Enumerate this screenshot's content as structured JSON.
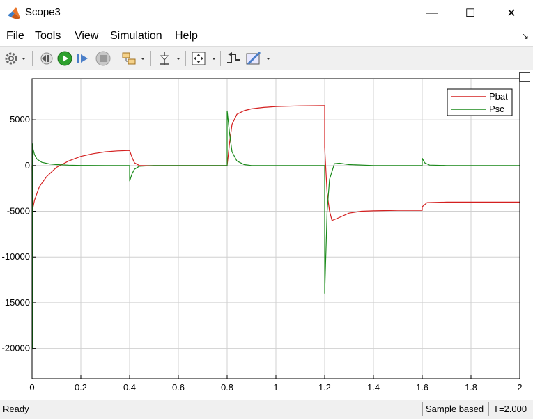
{
  "window": {
    "title": "Scope3",
    "minimize_glyph": "—",
    "maximize_glyph": "☐",
    "close_glyph": "✕"
  },
  "menu": {
    "items": [
      "File",
      "Tools",
      "View",
      "Simulation",
      "Help"
    ],
    "overflow_glyph": "↘"
  },
  "toolbar": {
    "buttons": [
      "settings-gear-icon",
      "step-back-icon",
      "run-icon",
      "step-forward-icon",
      "stop-icon",
      "highlight-block-icon",
      "cursor-measure-icon",
      "zoom-fit-icon",
      "triggers-icon",
      "style-icon"
    ]
  },
  "colors": {
    "pbat": "#d42020",
    "psc": "#1a8a1a",
    "grid": "#d0d0d0",
    "axis": "#000000"
  },
  "chart_data": {
    "type": "line",
    "title": "",
    "xlabel": "",
    "ylabel": "",
    "xlim": [
      0,
      2
    ],
    "ylim": [
      -23300,
      9500
    ],
    "x_ticks": [
      0,
      0.2,
      0.4,
      0.6,
      0.8,
      1,
      1.2,
      1.4,
      1.6,
      1.8,
      2
    ],
    "x_tick_labels": [
      "0",
      "0.2",
      "0.4",
      "0.6",
      "0.8",
      "1",
      "1.2",
      "1.4",
      "1.6",
      "1.8",
      "2"
    ],
    "y_ticks": [
      5000,
      0,
      -5000,
      -10000,
      -15000,
      -20000
    ],
    "y_tick_labels": [
      "5000",
      "0",
      "-5000",
      "-10000",
      "-15000",
      "-20000"
    ],
    "grid": true,
    "legend_position": "top-right",
    "series": [
      {
        "name": "Pbat",
        "x": [
          0,
          0.002,
          0.01,
          0.03,
          0.06,
          0.1,
          0.15,
          0.2,
          0.25,
          0.3,
          0.35,
          0.4,
          0.41,
          0.42,
          0.44,
          0.5,
          0.6,
          0.7,
          0.8,
          0.81,
          0.82,
          0.84,
          0.87,
          0.9,
          0.95,
          1.0,
          1.1,
          1.2,
          1.2,
          1.21,
          1.22,
          1.23,
          1.25,
          1.3,
          1.35,
          1.4,
          1.5,
          1.6,
          1.6,
          1.62,
          1.7,
          1.8,
          1.9,
          2.0
        ],
        "y": [
          0,
          -4800,
          -3800,
          -2300,
          -1200,
          -200,
          500,
          1000,
          1300,
          1500,
          1600,
          1650,
          900,
          300,
          0,
          0,
          0,
          0,
          0,
          2500,
          4500,
          5600,
          6000,
          6200,
          6350,
          6450,
          6520,
          6550,
          2000,
          -3000,
          -5000,
          -6000,
          -5800,
          -5200,
          -5000,
          -4950,
          -4900,
          -4900,
          -4500,
          -4050,
          -4000,
          -4000,
          -4000,
          -4000
        ]
      },
      {
        "name": "Psc",
        "x": [
          0,
          0.001,
          0.002,
          0.004,
          0.01,
          0.02,
          0.04,
          0.07,
          0.1,
          0.15,
          0.2,
          0.3,
          0.4,
          0.4,
          0.41,
          0.42,
          0.44,
          0.5,
          0.6,
          0.7,
          0.8,
          0.8,
          0.81,
          0.82,
          0.84,
          0.87,
          0.9,
          1.0,
          1.1,
          1.2,
          1.2,
          1.205,
          1.21,
          1.22,
          1.24,
          1.26,
          1.3,
          1.4,
          1.5,
          1.6,
          1.6,
          1.61,
          1.63,
          1.7,
          1.8,
          2.0
        ],
        "y": [
          0,
          -20000,
          2400,
          1800,
          1200,
          700,
          350,
          180,
          100,
          40,
          10,
          0,
          0,
          -1700,
          -900,
          -400,
          -80,
          0,
          0,
          0,
          0,
          6000,
          3500,
          1500,
          500,
          100,
          0,
          0,
          0,
          0,
          -14000,
          -9500,
          -5000,
          -1500,
          200,
          250,
          100,
          0,
          0,
          0,
          800,
          300,
          50,
          0,
          0,
          0
        ]
      }
    ]
  },
  "status": {
    "left": "Ready",
    "sample": "Sample based",
    "time": "T=2.000"
  }
}
